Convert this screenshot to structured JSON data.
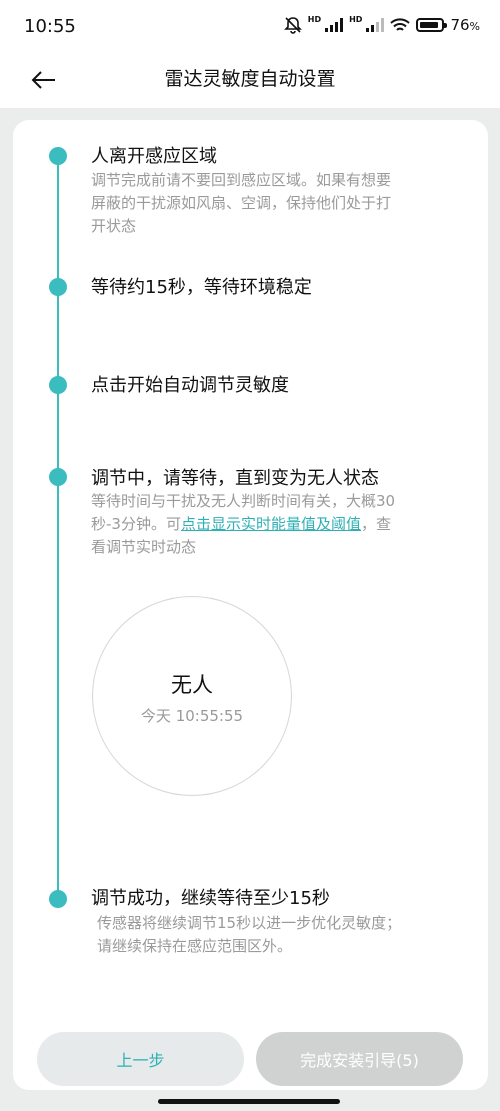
{
  "status_bar": {
    "time": "10:55",
    "battery_percent": "76",
    "battery_suffix": "%",
    "network_label": "HD"
  },
  "header": {
    "title": "雷达灵敏度自动设置"
  },
  "steps": [
    {
      "title": "人离开感应区域",
      "desc_lines": [
        "调节完成前请不要回到感应区域。如果有想要",
        "屏蔽的干扰源如风扇、空调，保持他们处于打",
        "开状态"
      ]
    },
    {
      "title": "等待约15秒，等待环境稳定"
    },
    {
      "title": "点击开始自动调节灵敏度"
    },
    {
      "title": "调节中，请等待，直到变为无人状态",
      "desc_line1": "等待时间与干扰及无人判断时间有关，大概30",
      "desc_line2_prefix": "秒-3分钟。可",
      "desc_link": "点击显示实时能量值及阈值",
      "desc_line2_suffix": "，查",
      "desc_line3": "看调节实时动态"
    },
    {
      "title": "调节成功，继续等待至少15秒",
      "desc_lines": [
        "传感器将继续调节15秒以进一步优化灵敏度；",
        "请继续保持在感应范围区外。"
      ]
    }
  ],
  "presence": {
    "status": "无人",
    "time": "今天 10:55:55"
  },
  "buttons": {
    "prev_label": "上一步",
    "done_label": "完成安装引导(5)"
  },
  "colors": {
    "accent": "#3bbcbf",
    "link": "#2fb0b4",
    "disabled_button": "#d0d2d2",
    "secondary_text": "#9a9a9a"
  }
}
